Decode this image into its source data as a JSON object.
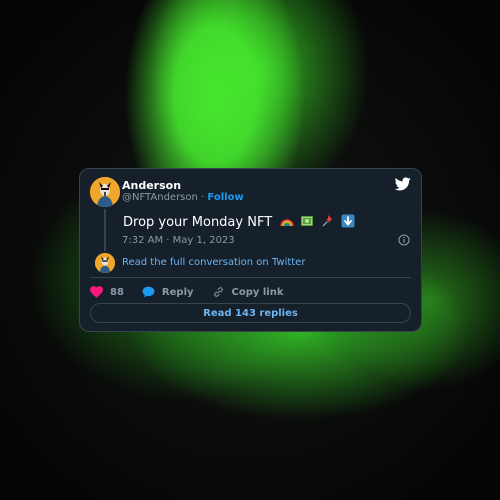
{
  "tweet": {
    "author_name": "Anderson",
    "handle": "@NFTAnderson",
    "separator": "·",
    "follow_label": "Follow",
    "text": "Drop your Monday NFT",
    "emojis": [
      "rainbow-emoji",
      "money-emoji",
      "pushpin-emoji",
      "down-arrow-emoji"
    ],
    "timestamp": "7:32 AM · May 1, 2023",
    "read_conversation_label": "Read the full conversation on Twitter",
    "like_count": "88",
    "reply_label": "Reply",
    "copy_link_label": "Copy link",
    "read_replies_label": "Read 143 replies"
  },
  "icons": {
    "brand": "twitter-bird-icon",
    "info": "info-icon",
    "like": "heart-icon",
    "reply": "speech-bubble-icon",
    "copy": "link-icon"
  },
  "colors": {
    "card_bg": "#15202b",
    "link": "#1d9bf0",
    "like": "#f91880",
    "muted": "#8b98a5",
    "background_glow": "#46e62e"
  }
}
